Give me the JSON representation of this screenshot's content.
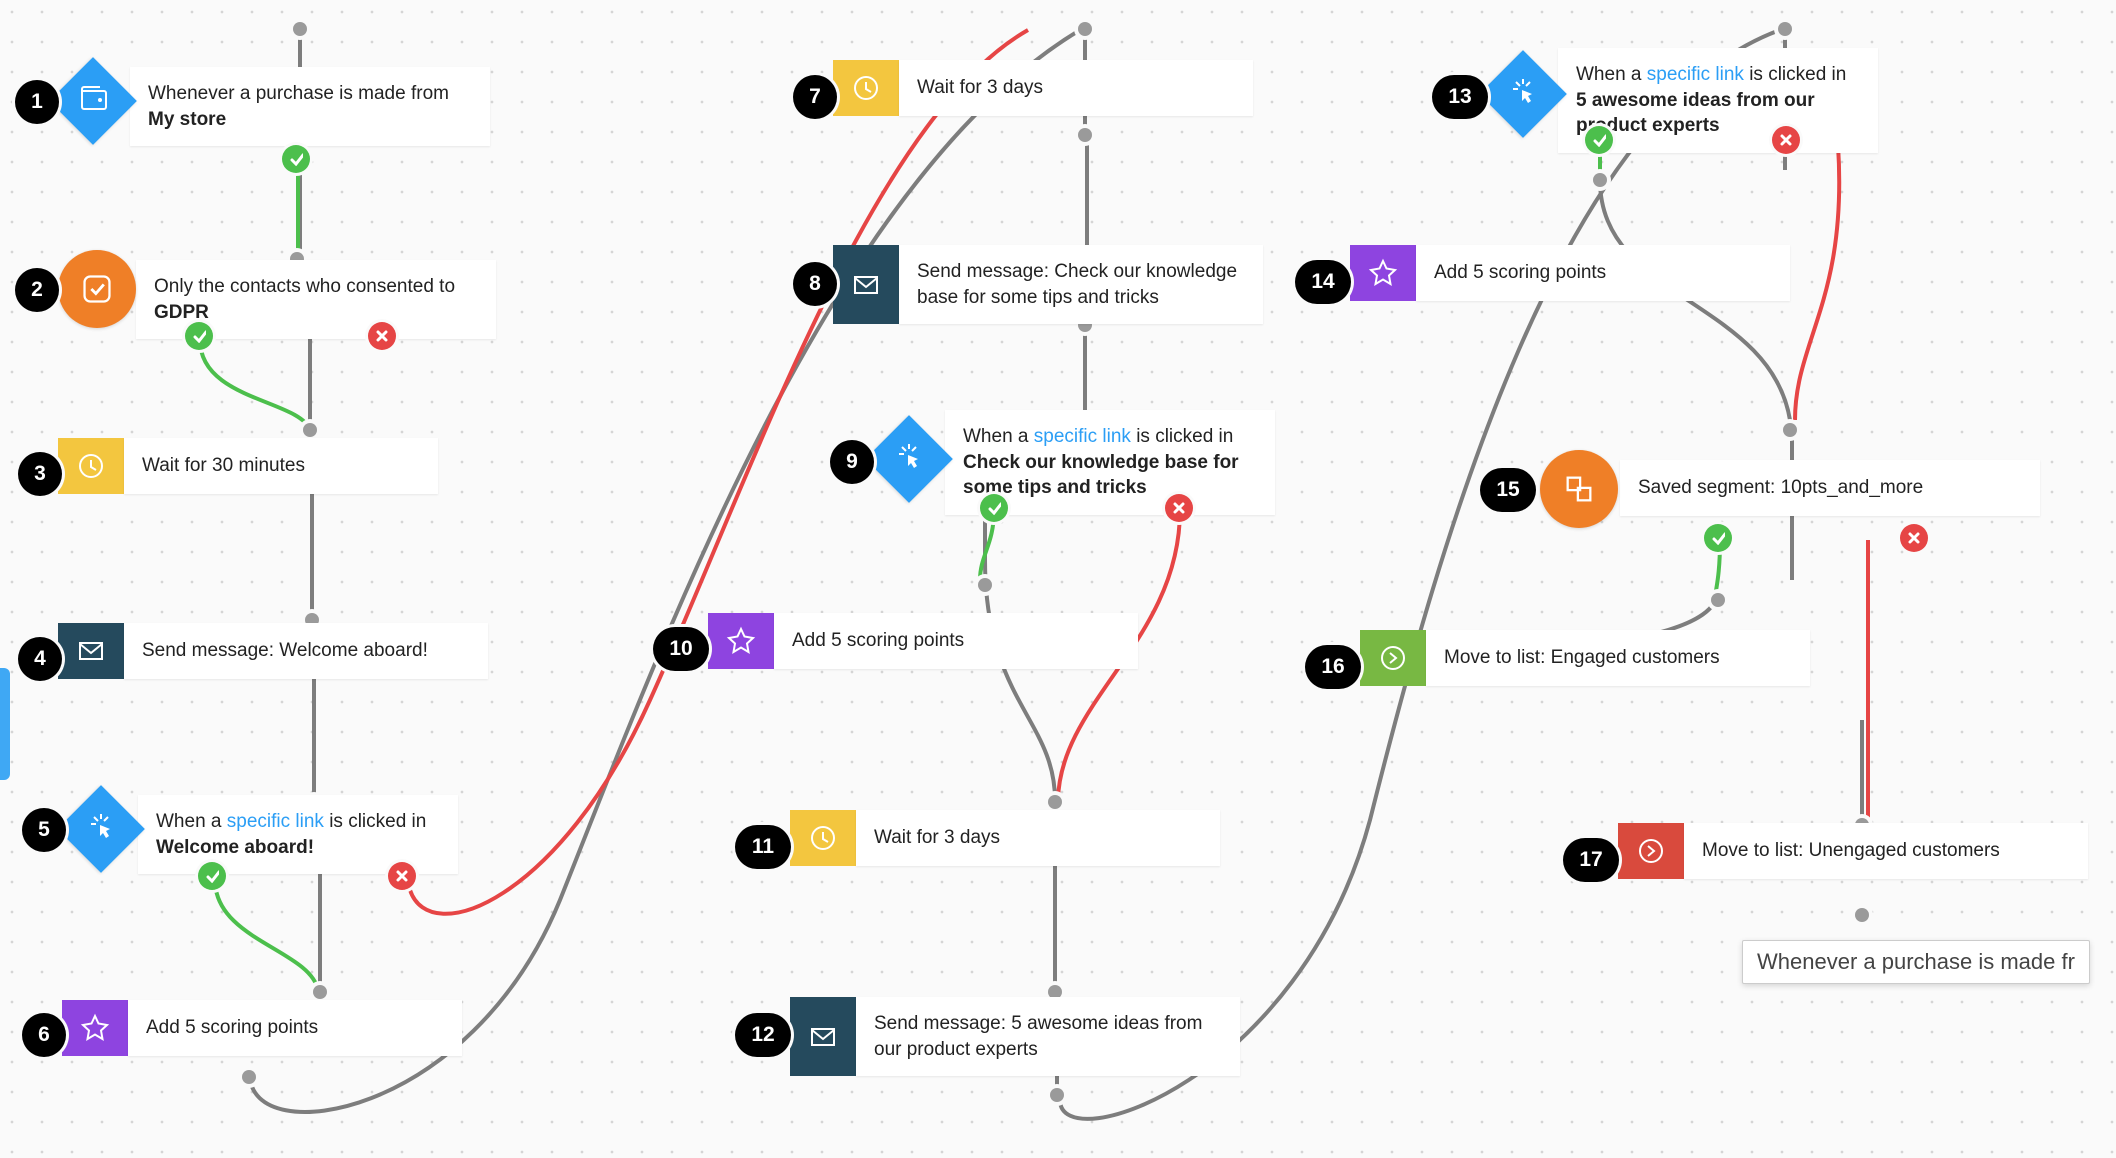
{
  "tooltip": "Whenever a purchase is made fr",
  "link_text": "specific link",
  "nodes": {
    "n1": {
      "num": "1",
      "text_before": "Whenever a purchase is made from ",
      "text_bold": "My store"
    },
    "n2": {
      "num": "2",
      "text_before": "Only the contacts who consented to ",
      "text_bold": "GDPR"
    },
    "n3": {
      "num": "3",
      "text": "Wait for 30 minutes"
    },
    "n4": {
      "num": "4",
      "text": "Send message: Welcome aboard!"
    },
    "n5": {
      "num": "5",
      "text_before": "When a ",
      "text_mid": " is clicked in ",
      "text_bold": "Welcome aboard!"
    },
    "n6": {
      "num": "6",
      "text": "Add 5 scoring points"
    },
    "n7": {
      "num": "7",
      "text": "Wait for 3 days"
    },
    "n8": {
      "num": "8",
      "text": "Send message: Check our knowledge base for some tips and tricks"
    },
    "n9": {
      "num": "9",
      "text_before": "When a ",
      "text_mid": " is clicked in ",
      "text_bold": "Check our knowledge base for some tips and tricks"
    },
    "n10": {
      "num": "10",
      "text": "Add 5 scoring points"
    },
    "n11": {
      "num": "11",
      "text": "Wait for 3 days"
    },
    "n12": {
      "num": "12",
      "text": "Send message: 5 awesome ideas from our product experts"
    },
    "n13": {
      "num": "13",
      "text_before": "When a ",
      "text_mid": " is clicked in ",
      "text_bold": "5 awesome ideas from our product experts"
    },
    "n14": {
      "num": "14",
      "text": "Add 5 scoring points"
    },
    "n15": {
      "num": "15",
      "text": "Saved segment: 10pts_and_more"
    },
    "n16": {
      "num": "16",
      "text": "Move to list: Engaged customers"
    },
    "n17": {
      "num": "17",
      "text": "Move to list: Unengaged customers"
    }
  }
}
